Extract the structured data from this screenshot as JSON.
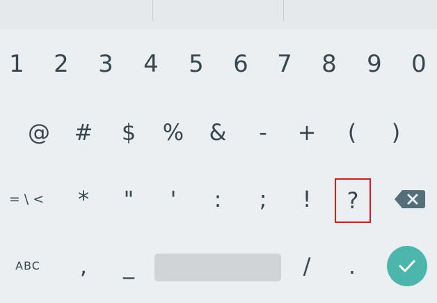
{
  "keyboard": {
    "row1": [
      "1",
      "2",
      "3",
      "4",
      "5",
      "6",
      "7",
      "8",
      "9",
      "0"
    ],
    "row2": [
      "@",
      "#",
      "$",
      "%",
      "&",
      "-",
      "+",
      "(",
      ")"
    ],
    "row3": {
      "more_symbols": "= \\ <",
      "keys": [
        "*",
        "\"",
        "'",
        ":",
        ";",
        "!",
        "?"
      ]
    },
    "row4": {
      "abc": "ABC",
      "comma": ",",
      "underscore": "_",
      "slash": "/",
      "period": "."
    },
    "icons": {
      "backspace": "backspace-icon",
      "enter": "checkmark-icon"
    },
    "colors": {
      "background": "#eceff1",
      "key_text": "#37474f",
      "enter_button": "#4db6ac",
      "highlight": "#e0191f"
    }
  }
}
